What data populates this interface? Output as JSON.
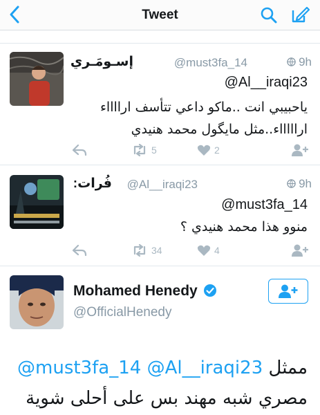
{
  "nav": {
    "title": "Tweet",
    "back_icon": "chevron-left-icon",
    "search_icon": "search-icon",
    "compose_icon": "compose-icon",
    "accent": "#1da1f2"
  },
  "tweets": [
    {
      "display_name": "إسـومَـري",
      "handle": "@must3fa_14",
      "time": "9h",
      "reply_to": "@Al__iraqi23",
      "lines": [
        "ياحبيبي انت ..ماكو داعي تتأسف ارااااء",
        "اراااااء..مثل مايگول محمد هنيدي"
      ],
      "retweets": "5",
      "likes": "2"
    },
    {
      "display_name": "فُرات:",
      "handle": "@Al__iraqi23",
      "time": "9h",
      "reply_to": "@must3fa_14",
      "lines": [
        "منوو هذا محمد هنيدي ؟"
      ],
      "retweets": "34",
      "likes": "4"
    }
  ],
  "main": {
    "display_name": "Mohamed Henedy",
    "handle": "@OfficialHenedy",
    "text_word1": "ممثل",
    "mention1": "@must3fa_14",
    "mention2": "@Al__iraqi23",
    "text_line2": "مصري شبه مهند بس على أحلى شوية"
  },
  "colors": {
    "icon_gray": "#aab8c2",
    "meta_gray": "#8899a6"
  }
}
